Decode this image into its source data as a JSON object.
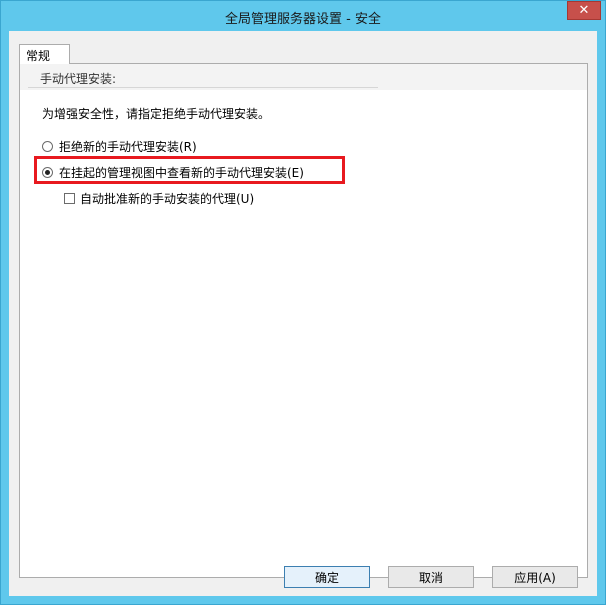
{
  "window": {
    "title": "全局管理服务器设置 - 安全",
    "close_label": "✕"
  },
  "tabs": [
    {
      "label": "常规"
    }
  ],
  "section": {
    "heading": "手动代理安装:",
    "description": "为增强安全性，请指定拒绝手动代理安装。"
  },
  "options": {
    "reject": {
      "label": "拒绝新的手动代理安装(R)",
      "checked": false
    },
    "pending": {
      "label": "在挂起的管理视图中查看新的手动代理安装(E)",
      "checked": true
    },
    "auto_approve": {
      "label": "自动批准新的手动安装的代理(U)",
      "checked": false
    }
  },
  "buttons": {
    "ok": "确定",
    "cancel": "取消",
    "apply": "应用(A)"
  },
  "colors": {
    "titlebar": "#5fc8ec",
    "highlight": "#e8191f"
  }
}
